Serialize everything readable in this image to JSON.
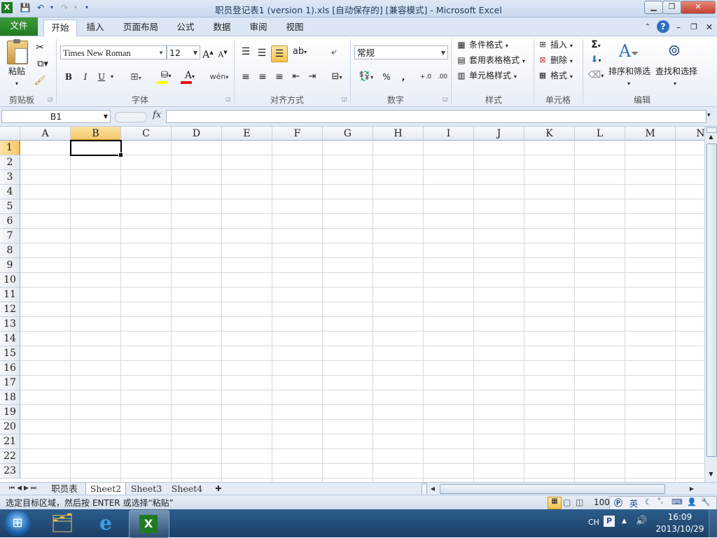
{
  "window": {
    "title": "职员登记表1 (version 1).xls  [自动保存的]  [兼容模式]  -  Microsoft Excel",
    "minimize_icon": "minimize-icon",
    "maximize_icon": "restore-icon",
    "close_icon": "close-icon"
  },
  "tabs": [
    {
      "label": "文件"
    },
    {
      "label": "开始"
    },
    {
      "label": "插入"
    },
    {
      "label": "页面布局"
    },
    {
      "label": "公式"
    },
    {
      "label": "数据"
    },
    {
      "label": "审阅"
    },
    {
      "label": "视图"
    }
  ],
  "ribbon": {
    "clipboard": {
      "label": "剪贴板",
      "paste": "粘贴"
    },
    "font": {
      "label": "字体",
      "family": "Times New Roman",
      "size": "12",
      "bold": "B",
      "italic": "I",
      "underline": "U",
      "phonetic": "wén"
    },
    "alignment": {
      "label": "对齐方式"
    },
    "number": {
      "label": "数字",
      "format": "常规",
      "percent": "%",
      "comma": ","
    },
    "styles": {
      "label": "样式",
      "conditional": "条件格式",
      "table": "套用表格格式",
      "cell": "单元格样式"
    },
    "cells": {
      "label": "单元格",
      "insert": "插入",
      "delete": "删除",
      "format": "格式"
    },
    "editing": {
      "label": "编辑",
      "sigma": "Σ",
      "sort": "排序和筛选",
      "find": "查找和选择"
    }
  },
  "formula_bar": {
    "name_box": "B1",
    "fx": "fx",
    "content": ""
  },
  "columns": [
    "A",
    "B",
    "C",
    "D",
    "E",
    "F",
    "G",
    "H",
    "I",
    "J",
    "K",
    "L",
    "M",
    "N"
  ],
  "rows": [
    "1",
    "2",
    "3",
    "4",
    "5",
    "6",
    "7",
    "8",
    "9",
    "10",
    "11",
    "12",
    "13",
    "14",
    "15",
    "16",
    "17",
    "18",
    "19",
    "20",
    "21",
    "22",
    "23"
  ],
  "selected_cell": "B1",
  "sheets": [
    {
      "label": "职员表"
    },
    {
      "label": "Sheet2"
    },
    {
      "label": "Sheet3"
    },
    {
      "label": "Sheet4"
    }
  ],
  "active_sheet": "Sheet2",
  "status": {
    "message": "选定目标区域，然后按 ENTER 或选择“粘贴”",
    "zoom": "100"
  },
  "ime": {
    "lang": "英"
  },
  "taskbar": {
    "lang": "CH",
    "time": "16:09",
    "date": "2013/10/29"
  },
  "colors": {
    "excel_green": "#1f7a22",
    "selection_orange": "#f5c86a",
    "ribbon_blue": "#dce6f4"
  }
}
